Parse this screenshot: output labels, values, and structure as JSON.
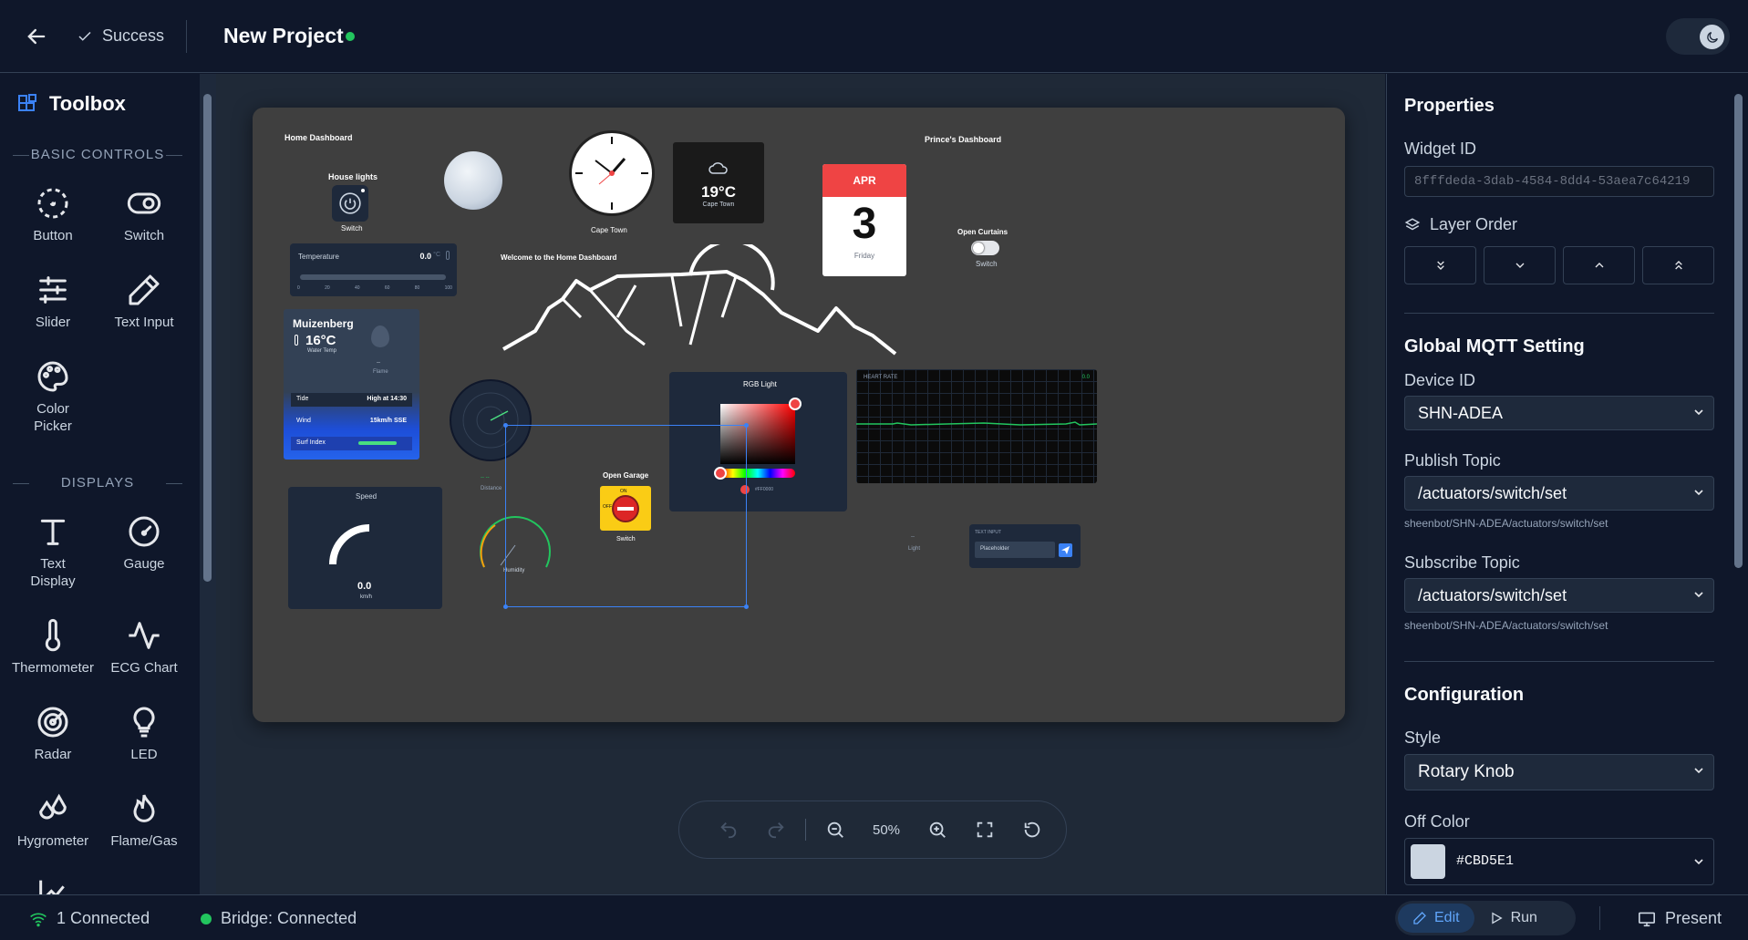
{
  "header": {
    "status": "Success",
    "project_title": "New Project"
  },
  "toolbox": {
    "title": "Toolbox",
    "sections": {
      "basic": "BASIC CONTROLS",
      "displays": "DISPLAYS"
    },
    "items": [
      "Button",
      "Switch",
      "Slider",
      "Text Input",
      "Color Picker",
      "Text Display",
      "Gauge",
      "Thermometer",
      "ECG Chart",
      "Radar",
      "LED",
      "Hygrometer",
      "Flame/Gas"
    ]
  },
  "canvas": {
    "home_dashboard": "Home Dashboard",
    "house_lights": "House lights",
    "switch": "Switch",
    "cape_town_clock": "Cape Town",
    "weather_temp": "19°C",
    "weather_city": "Cape Town",
    "cal_month": "APR",
    "cal_day": "3",
    "cal_weekday": "Friday",
    "princes_dashboard": "Prince's Dashboard",
    "open_curtains": "Open Curtains",
    "welcome": "Welcome to the Home Dashboard",
    "temperature_label": "Temperature",
    "temperature_value": "0.0",
    "temperature_unit": "°C",
    "slider_ticks": [
      "0",
      "20",
      "40",
      "60",
      "80",
      "100"
    ],
    "muizenberg_title": "Muizenberg",
    "muizenberg_temp": "16°C",
    "water_temp": "Water Temp",
    "flame_label": "Flame",
    "flame_value": "--",
    "tide_label": "Tide",
    "tide_value": "High at 14:30",
    "wind_label": "Wind",
    "wind_value": "15km/h SSE",
    "surf_label": "Surf Index",
    "distance_label": "Distance",
    "distance_value": "-- --",
    "rgb_title": "RGB Light",
    "rgb_hex": "#FF0000",
    "heart_rate": "HEART RATE",
    "heart_value": "0.0",
    "open_garage": "Open Garage",
    "garage_on": "ON",
    "garage_off": "OFF",
    "speed_label": "Speed",
    "speed_value": "0.0",
    "speed_unit": "km/h",
    "humidity_label": "Humidity",
    "light_label": "Light",
    "light_value": "--",
    "text_input_label": "TEXT INPUT",
    "text_input_placeholder": "Placeholder"
  },
  "zoom": {
    "level": "50%"
  },
  "properties": {
    "title": "Properties",
    "widget_id_label": "Widget ID",
    "widget_id": "8fffdeda-3dab-4584-8dd4-53aea7c64219",
    "layer_order_label": "Layer Order",
    "mqtt_title": "Global MQTT Setting",
    "device_id_label": "Device ID",
    "device_id": "SHN-ADEA",
    "publish_label": "Publish Topic",
    "publish_topic": "/actuators/switch/set",
    "publish_full": "sheenbot/SHN-ADEA/actuators/switch/set",
    "subscribe_label": "Subscribe Topic",
    "subscribe_topic": "/actuators/switch/set",
    "subscribe_full": "sheenbot/SHN-ADEA/actuators/switch/set",
    "config_title": "Configuration",
    "style_label": "Style",
    "style_value": "Rotary Knob",
    "off_color_label": "Off Color",
    "off_color": "#CBD5E1"
  },
  "footer": {
    "connected": "1 Connected",
    "bridge": "Bridge: Connected",
    "edit": "Edit",
    "run": "Run",
    "present": "Present"
  },
  "colors": {
    "accent": "#3b82f6",
    "success": "#22c55e",
    "calendar_red": "#ef4444",
    "ecg_green": "#22c55e"
  }
}
